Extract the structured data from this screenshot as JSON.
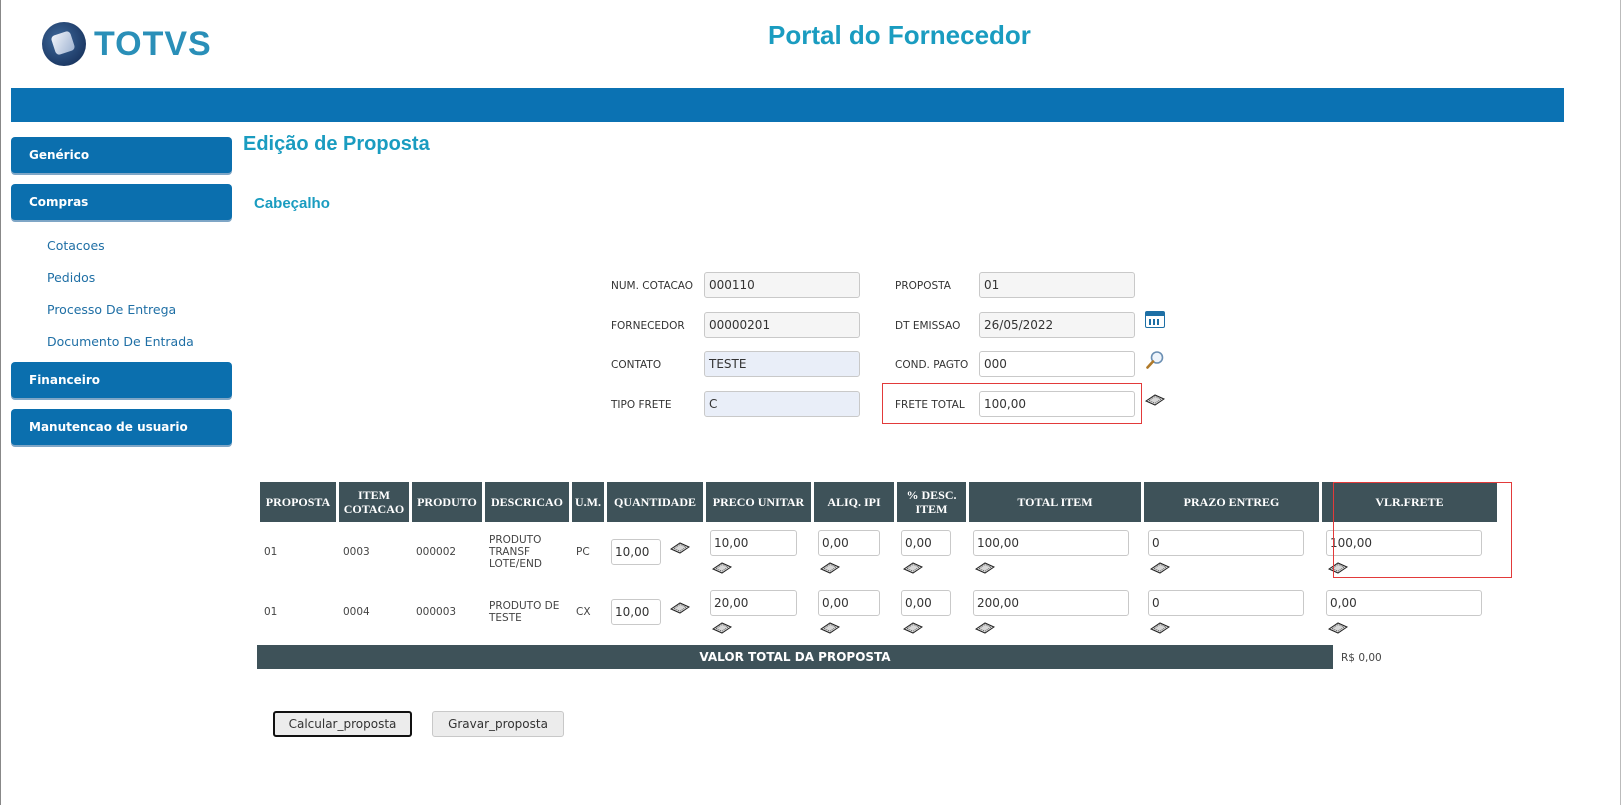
{
  "header": {
    "logo_text": "TOTVS",
    "portal_title": "Portal do Fornecedor"
  },
  "sidebar": {
    "sections": [
      "Genérico",
      "Compras",
      "Financeiro",
      "Manutencao de usuario"
    ],
    "sub_items": [
      "Cotacoes",
      "Pedidos",
      "Processo De Entrega",
      "Documento De Entrada"
    ]
  },
  "main": {
    "page_title": "Edição de Proposta",
    "section_title": "Cabeçalho"
  },
  "form": {
    "num_cotacao": {
      "label": "NUM. COTACAO",
      "value": "000110"
    },
    "proposta": {
      "label": "PROPOSTA",
      "value": "01"
    },
    "fornecedor": {
      "label": "FORNECEDOR",
      "value": "00000201"
    },
    "dt_emissao": {
      "label": "DT EMISSAO",
      "value": "26/05/2022"
    },
    "contato": {
      "label": "CONTATO",
      "value": "TESTE"
    },
    "cond_pagto": {
      "label": "COND. PAGTO",
      "value": "000"
    },
    "tipo_frete": {
      "label": "TIPO FRETE",
      "value": "C"
    },
    "frete_total": {
      "label": "FRETE TOTAL",
      "value": "100,00"
    }
  },
  "table": {
    "headers": [
      "PROPOSTA",
      "ITEM COTACAO",
      "PRODUTO",
      "DESCRICAO",
      "U.M.",
      "QUANTIDADE",
      "PRECO UNITAR",
      "ALIQ. IPI",
      "% DESC. ITEM",
      "TOTAL ITEM",
      "PRAZO ENTREG",
      "VLR.FRETE"
    ],
    "rows": [
      {
        "proposta": "01",
        "item": "0003",
        "produto": "000002",
        "descricao": "PRODUTO TRANSF LOTE/END",
        "um": "PC",
        "quantidade": "10,00",
        "preco": "10,00",
        "ipi": "0,00",
        "desc": "0,00",
        "total": "100,00",
        "prazo": "0",
        "frete": "100,00"
      },
      {
        "proposta": "01",
        "item": "0004",
        "produto": "000003",
        "descricao": "PRODUTO DE TESTE",
        "um": "CX",
        "quantidade": "10,00",
        "preco": "20,00",
        "ipi": "0,00",
        "desc": "0,00",
        "total": "200,00",
        "prazo": "0",
        "frete": "0,00"
      }
    ],
    "total_label": "VALOR TOTAL DA PROPOSTA",
    "total_value": "R$ 0,00"
  },
  "buttons": {
    "calcular": "Calcular_proposta",
    "gravar": "Gravar_proposta"
  },
  "colors": {
    "brand_blue": "#0b72b3",
    "title_cyan": "#1a9cc0",
    "table_header": "#3e5259",
    "highlight_red": "#e23a3a"
  },
  "icons": [
    "calendar-icon",
    "search-icon",
    "calculator-icon"
  ]
}
